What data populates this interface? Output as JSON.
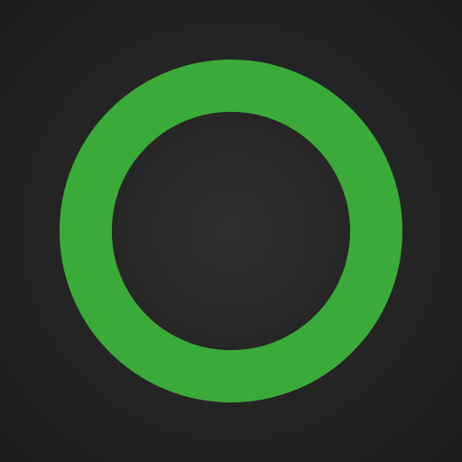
{
  "icon": {
    "name": "green-ring-icon",
    "ring_color": "#3aab39",
    "background_color": "#262626"
  }
}
